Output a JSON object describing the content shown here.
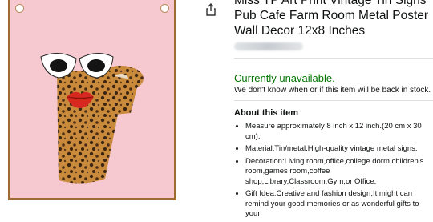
{
  "product": {
    "title": "Miss TP Art Print Vintage Tin Signs Pub Cafe Farm Room Metal Poster Wall Decor 12x8 Inches"
  },
  "icons": {
    "share": "share-icon"
  },
  "availability": {
    "status": "Currently unavailable.",
    "note": "We don't know when or if this item will be back in stock."
  },
  "about": {
    "heading": "About this item",
    "bullets": [
      "Measure approximately 8 inch x 12 inch.(20 cm x 30 cm).",
      "Material:Tin/metal.High-quality vintage metal signs.",
      "Decoration:Living room,office,college dorm,children's room,games room,coffee shop,Library,Classroom,Gym,or Office.",
      "Gift Idea:Creative and fashion design,It might can remind your good memories or as wonderful gifts to your"
    ]
  },
  "colors": {
    "availability_green": "#007600",
    "poster_pink": "#f5c9cf",
    "frame_brown": "#a06a33"
  }
}
